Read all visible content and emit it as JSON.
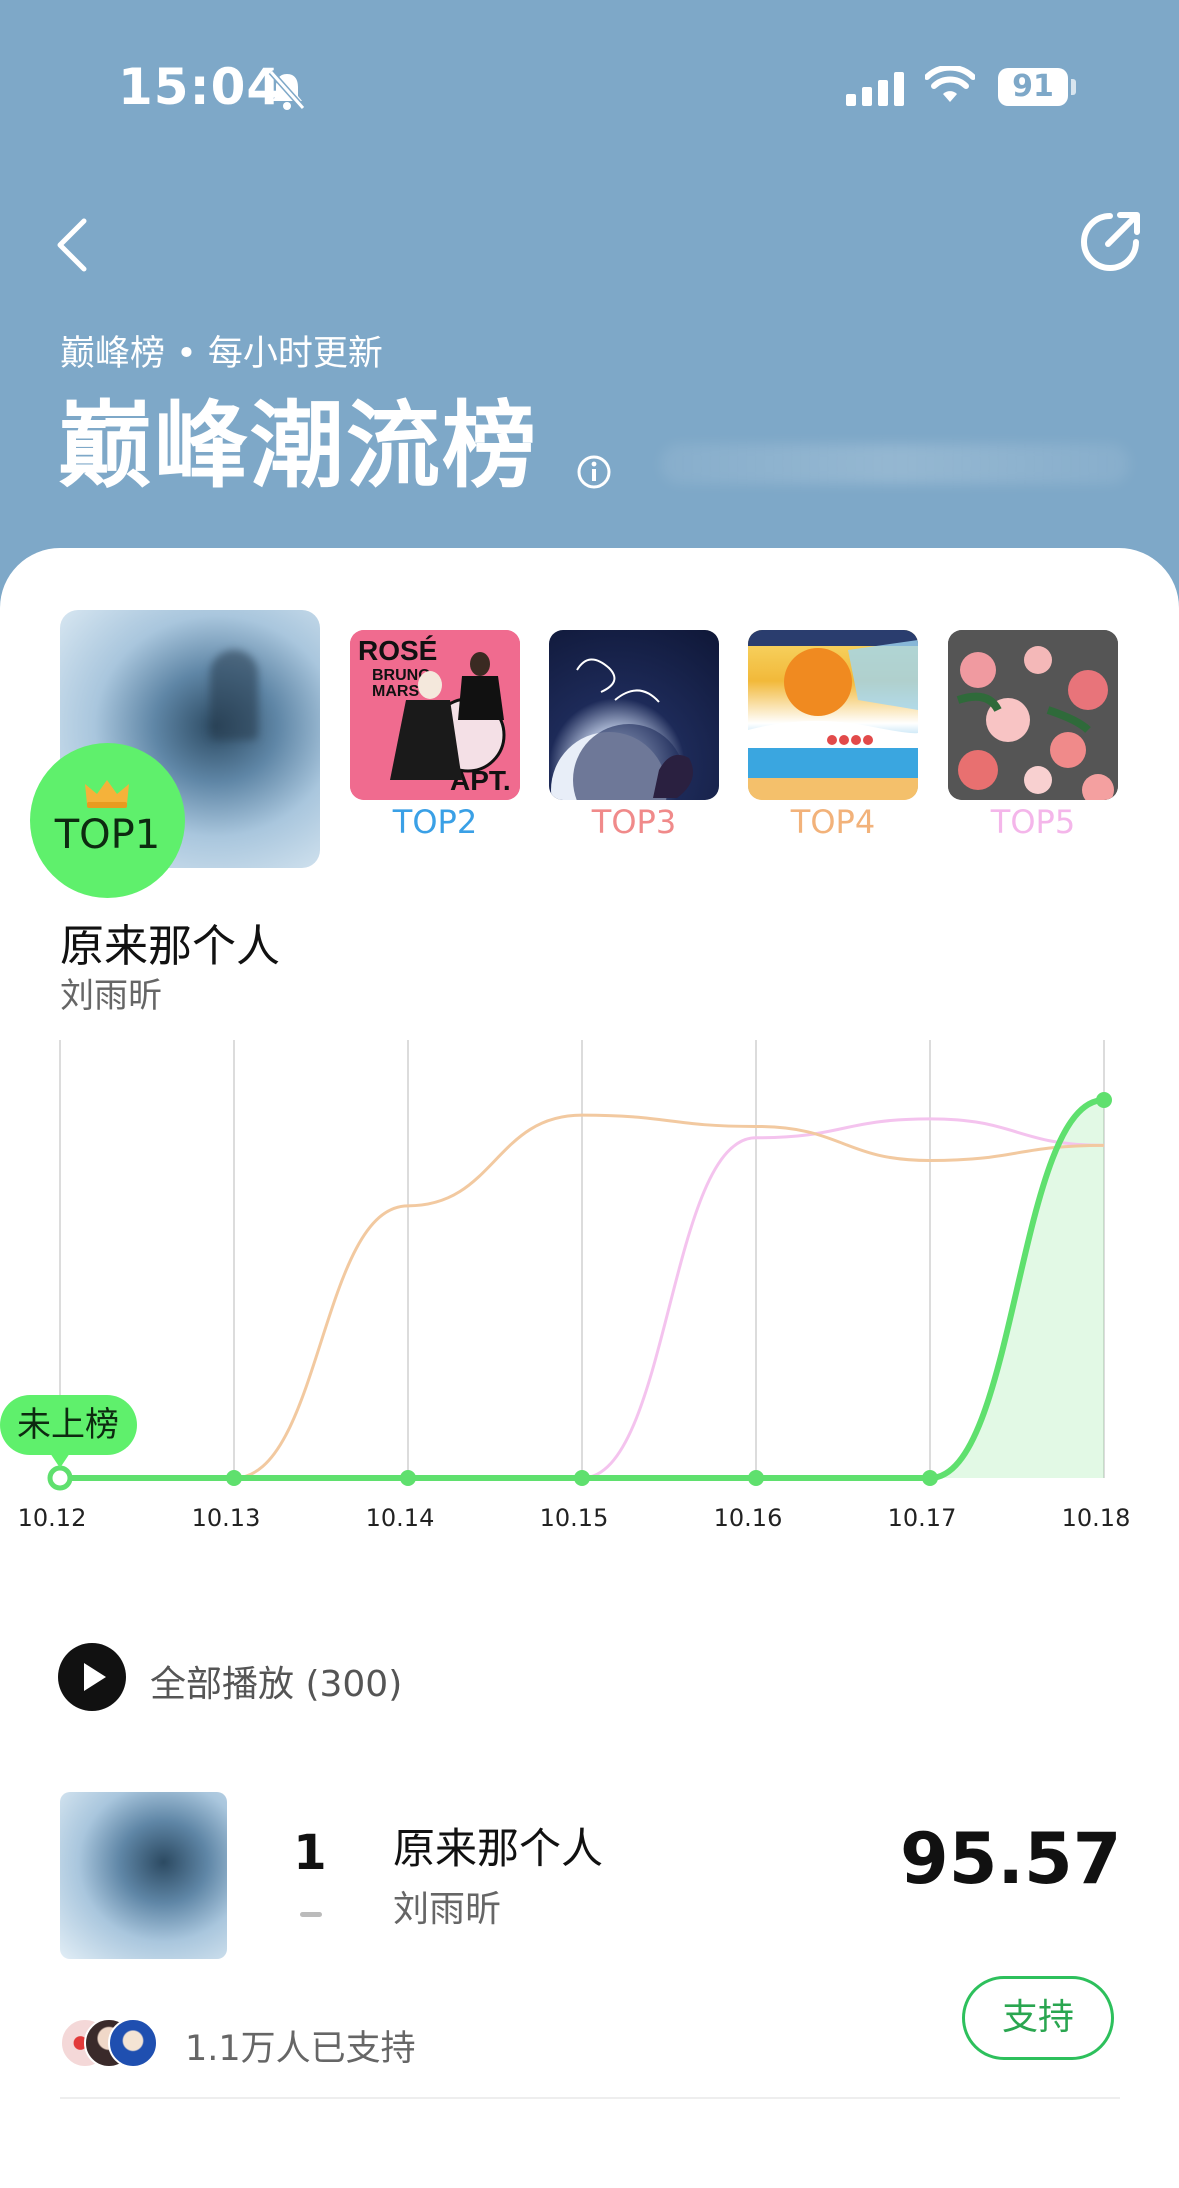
{
  "status_bar": {
    "time": "15:04",
    "battery": "91"
  },
  "header": {
    "subtitle": "巅峰榜 • 每小时更新",
    "title": "巅峰潮流榜"
  },
  "top_ranks": [
    {
      "label": "TOP1",
      "color": "#5ff06c"
    },
    {
      "label": "TOP2",
      "color": "#3aa0e6",
      "cover_text": [
        "ROSÉ",
        "BRUNO",
        "MARS",
        "APT."
      ]
    },
    {
      "label": "TOP3",
      "color": "#f08a8a"
    },
    {
      "label": "TOP4",
      "color": "#f2b27a"
    },
    {
      "label": "TOP5",
      "color": "#f4b6ea"
    }
  ],
  "top_song": {
    "title": "原来那个人",
    "artist": "刘雨昕"
  },
  "chart_data": {
    "type": "line",
    "categories": [
      "10.12",
      "10.13",
      "10.14",
      "10.15",
      "10.16",
      "10.17",
      "10.18"
    ],
    "badge": "未上榜",
    "series": [
      {
        "color": "#5fe06e",
        "values": [
          0,
          0,
          0,
          0,
          0,
          0,
          1.0
        ]
      },
      {
        "color": "#f2c9a0",
        "values": [
          0,
          0,
          0.72,
          0.96,
          0.93,
          0.84,
          0.88
        ]
      },
      {
        "color": "#f4c3ee",
        "values": [
          0,
          0,
          0,
          0,
          0.9,
          0.95,
          0.88
        ]
      }
    ],
    "grid": true
  },
  "play_all": {
    "label": "全部播放 (300)"
  },
  "song_list": [
    {
      "rank": "1",
      "title": "原来那个人",
      "artist": "刘雨昕",
      "score": "95.57"
    }
  ],
  "support": {
    "count_text": "1.1万人已支持",
    "button": "支持"
  }
}
